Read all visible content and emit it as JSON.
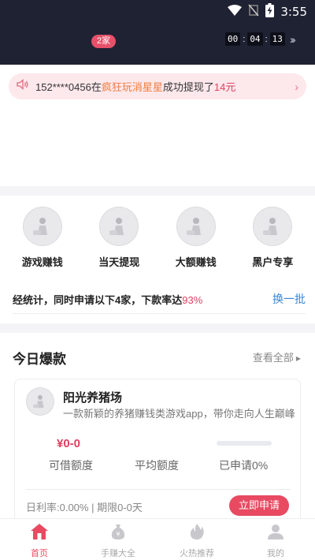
{
  "status_bar": {
    "time": "3:55"
  },
  "header": {
    "count_pill": "2家",
    "countdown": {
      "h": "00",
      "m": "04",
      "s": "13"
    }
  },
  "notice": {
    "prefix": "152****0456在",
    "game": "疯狂玩消星星",
    "middle": "成功提现了",
    "amount": "14元"
  },
  "categories": [
    {
      "label": "游戏赚钱"
    },
    {
      "label": "当天提现"
    },
    {
      "label": "大额赚钱"
    },
    {
      "label": "黑户专享"
    }
  ],
  "stats": {
    "text": "经统计，同时申请以下4家，下款率达",
    "percent": "93%",
    "swap_label": "换一批"
  },
  "today": {
    "title": "今日爆款",
    "view_all": "查看全部"
  },
  "card": {
    "name": "阳光养猪场",
    "description": "一款新颖的养猪赚钱类游戏app，带你走向人生巅峰",
    "amount_value": "¥0-0",
    "progress": 0,
    "labels": {
      "limit": "可借额度",
      "average": "平均额度",
      "applied": "已申请0%"
    },
    "footer": "日利率:0.00% | 期限0-0天",
    "apply_label": "立即申请"
  },
  "tabs": [
    {
      "label": "首页",
      "icon": "home-icon",
      "active": true
    },
    {
      "label": "手赚大全",
      "icon": "money-bag-icon",
      "active": false
    },
    {
      "label": "火热推荐",
      "icon": "flame-icon",
      "active": false
    },
    {
      "label": "我的",
      "icon": "user-icon",
      "active": false
    }
  ],
  "colors": {
    "header_bg": "#1f2233",
    "accent": "#e84a62",
    "link": "#3a86d8",
    "highlight_orange": "#f07c3c"
  }
}
